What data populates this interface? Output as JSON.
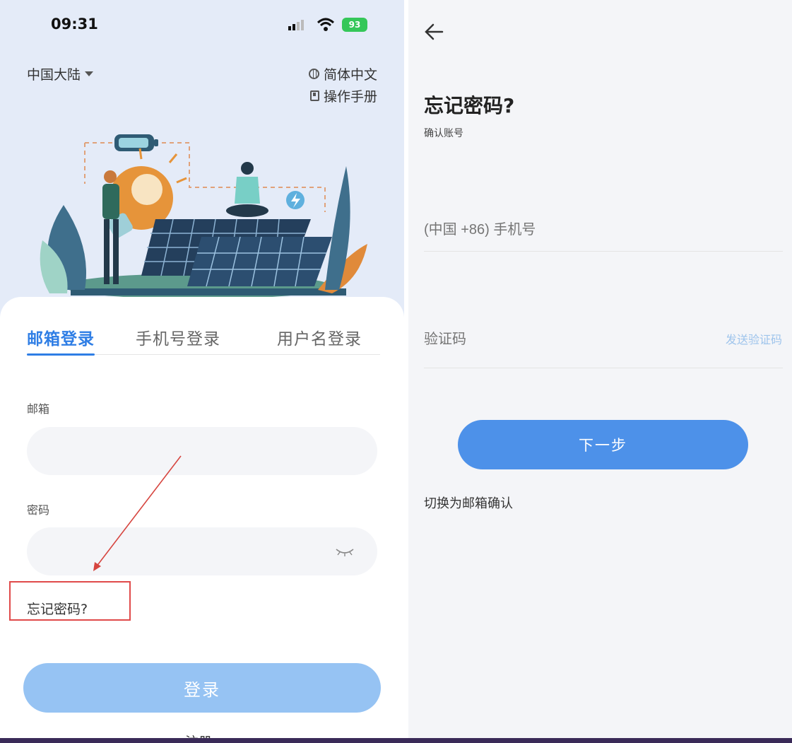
{
  "left": {
    "status": {
      "time": "09:31",
      "battery": "93"
    },
    "region": "中国大陆",
    "language": "简体中文",
    "manual": "操作手册",
    "tabs": [
      "邮箱登录",
      "手机号登录",
      "用户名登录"
    ],
    "email_label": "邮箱",
    "password_label": "密码",
    "forgot_password": "忘记密码?",
    "login_button": "登录",
    "register": "注册"
  },
  "right": {
    "title": "忘记密码?",
    "subtitle": "确认账号",
    "phone_placeholder": "(中国 +86) 手机号",
    "code_placeholder": "验证码",
    "send_code": "发送验证码",
    "next_button": "下一步",
    "switch_to_email": "切换为邮箱确认"
  },
  "colors": {
    "accent": "#2f7ee5",
    "button_disabled": "#96c3f3",
    "button_primary": "#4d91e9",
    "highlight_red": "#e04a4a",
    "panel_bg_left": "#e4ebf8",
    "panel_bg_right": "#f4f5f8"
  },
  "icons": [
    "wifi-icon",
    "signal-icon",
    "battery-icon",
    "globe-icon",
    "book-icon",
    "eye-closed-icon",
    "back-arrow-icon",
    "caret-down-icon"
  ]
}
